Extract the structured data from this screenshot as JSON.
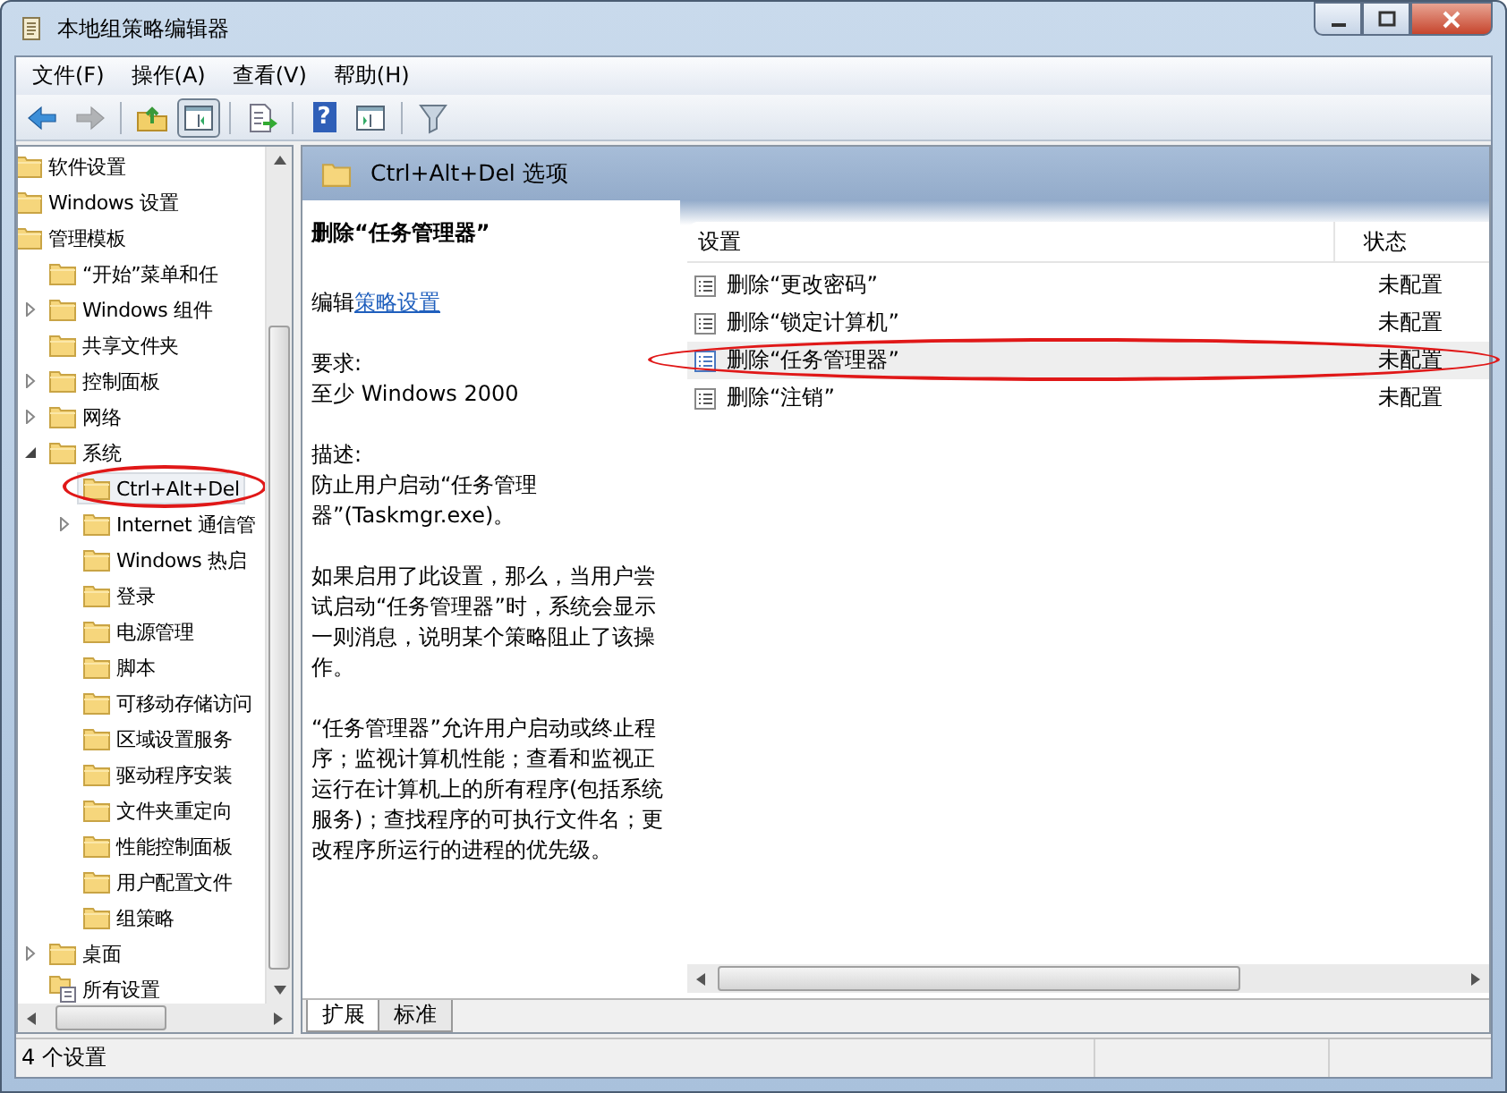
{
  "window": {
    "title": "本地组策略编辑器"
  },
  "menu": [
    {
      "label": "文件(F)"
    },
    {
      "label": "操作(A)"
    },
    {
      "label": "查看(V)"
    },
    {
      "label": "帮助(H)"
    }
  ],
  "toolbar": [
    {
      "kind": "back",
      "disabled": false,
      "pressed": false
    },
    {
      "kind": "forward",
      "disabled": true,
      "pressed": false
    },
    {
      "kind": "separator"
    },
    {
      "kind": "up",
      "disabled": false,
      "pressed": false
    },
    {
      "kind": "tree-toggle",
      "disabled": false,
      "pressed": true
    },
    {
      "kind": "separator"
    },
    {
      "kind": "export",
      "disabled": false,
      "pressed": false
    },
    {
      "kind": "separator"
    },
    {
      "kind": "help",
      "glyph": "?",
      "disabled": false,
      "pressed": false
    },
    {
      "kind": "pane-toggle",
      "disabled": false,
      "pressed": false
    },
    {
      "kind": "separator"
    },
    {
      "kind": "filter",
      "disabled": false,
      "pressed": false
    }
  ],
  "tree": [
    {
      "label": "软件设置",
      "kind": "folder",
      "selected": false,
      "circled": false
    },
    {
      "label": "Windows 设置",
      "kind": "folder",
      "selected": false,
      "circled": false
    },
    {
      "label": "管理模板",
      "kind": "folder",
      "selected": false,
      "circled": false,
      "children": [
        {
          "label": "“开始”菜单和任",
          "kind": "folder",
          "selected": false,
          "circled": false
        },
        {
          "label": "Windows 组件",
          "kind": "folder",
          "expanded": false,
          "selected": false,
          "circled": false
        },
        {
          "label": "共享文件夹",
          "kind": "folder",
          "selected": false,
          "circled": false
        },
        {
          "label": "控制面板",
          "kind": "folder",
          "expanded": false,
          "selected": false,
          "circled": false
        },
        {
          "label": "网络",
          "kind": "folder",
          "expanded": false,
          "selected": false,
          "circled": false
        },
        {
          "label": "系统",
          "kind": "folder",
          "expanded": true,
          "selected": false,
          "circled": false,
          "children": [
            {
              "label": "Ctrl+Alt+Del",
              "kind": "folder",
              "selected": true,
              "circled": true
            },
            {
              "label": "Internet 通信管",
              "kind": "folder",
              "expanded": false,
              "selected": false,
              "circled": false
            },
            {
              "label": "Windows 热启",
              "kind": "folder",
              "selected": false,
              "circled": false
            },
            {
              "label": "登录",
              "kind": "folder",
              "selected": false,
              "circled": false
            },
            {
              "label": "电源管理",
              "kind": "folder",
              "selected": false,
              "circled": false
            },
            {
              "label": "脚本",
              "kind": "folder",
              "selected": false,
              "circled": false
            },
            {
              "label": "可移动存储访问",
              "kind": "folder",
              "selected": false,
              "circled": false
            },
            {
              "label": "区域设置服务",
              "kind": "folder",
              "selected": false,
              "circled": false
            },
            {
              "label": "驱动程序安装",
              "kind": "folder",
              "selected": false,
              "circled": false
            },
            {
              "label": "文件夹重定向",
              "kind": "folder",
              "selected": false,
              "circled": false
            },
            {
              "label": "性能控制面板",
              "kind": "folder",
              "selected": false,
              "circled": false
            },
            {
              "label": "用户配置文件",
              "kind": "folder",
              "selected": false,
              "circled": false
            },
            {
              "label": "组策略",
              "kind": "folder",
              "selected": false,
              "circled": false
            }
          ]
        },
        {
          "label": "桌面",
          "kind": "folder",
          "expanded": false,
          "selected": false,
          "circled": false
        },
        {
          "label": "所有设置",
          "kind": "settings",
          "selected": false,
          "circled": false
        }
      ]
    }
  ],
  "details": {
    "header": "Ctrl+Alt+Del 选项",
    "title": "删除“任务管理器”",
    "edit_prefix": "编辑",
    "edit_link": "策略设置",
    "blocks": [
      {
        "label": "要求:",
        "text": "至少 Windows 2000"
      },
      {
        "label": "描述:",
        "text": "防止用户启动“任务管理器”(Taskmgr.exe)。"
      },
      {
        "text": "如果启用了此设置，那么，当用户尝试启动“任务管理器”时，系统会显示一则消息，说明某个策略阻止了该操作。"
      },
      {
        "text": "“任务管理器”允许用户启动或终止程序；监视计算机性能；查看和监视正运行在计算机上的所有程序(包括系统服务)；查找程序的可执行文件名；更改程序所运行的进程的优先级。"
      }
    ]
  },
  "list": {
    "columns": [
      "设置",
      "状态"
    ],
    "rows": [
      {
        "name": "删除“更改密码”",
        "state": "未配置",
        "selected": false,
        "circled": false
      },
      {
        "name": "删除“锁定计算机”",
        "state": "未配置",
        "selected": false,
        "circled": false
      },
      {
        "name": "删除“任务管理器”",
        "state": "未配置",
        "selected": true,
        "circled": true
      },
      {
        "name": "删除“注销”",
        "state": "未配置",
        "selected": false,
        "circled": false
      }
    ]
  },
  "tabs": [
    {
      "label": "扩展",
      "selected": true
    },
    {
      "label": "标准",
      "selected": false
    }
  ],
  "status_bar": {
    "text": "4 个设置"
  }
}
